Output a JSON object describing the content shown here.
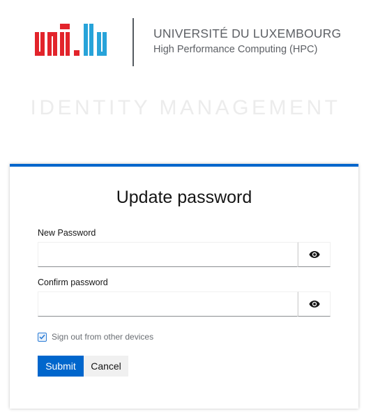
{
  "header": {
    "logo_text": "uni.lu",
    "university_name": "UNIVERSITÉ DU LUXEMBOURG",
    "department": "High Performance Computing (HPC)",
    "logo_colors": {
      "red": "#e2242b",
      "blue": "#27a3d9"
    }
  },
  "realm_title": "IDENTITY MANAGEMENT",
  "form": {
    "title": "Update password",
    "new_password": {
      "label": "New Password",
      "value": "",
      "toggle_icon": "eye-icon"
    },
    "confirm_password": {
      "label": "Confirm password",
      "value": "",
      "toggle_icon": "eye-icon"
    },
    "logout_sessions": {
      "label": "Sign out from other devices",
      "checked": true
    },
    "submit_label": "Submit",
    "cancel_label": "Cancel"
  },
  "colors": {
    "accent": "#0066cc",
    "card_border_top": "#0066cc",
    "realm_title": "#ececec"
  }
}
